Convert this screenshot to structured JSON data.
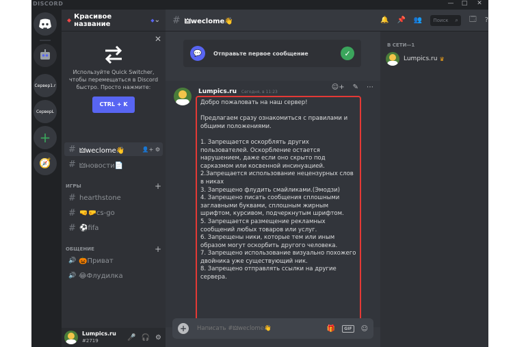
{
  "titlebar": {
    "brand": "DISCORD",
    "min": "—",
    "max": "□",
    "close": "✕"
  },
  "guilds": [
    {
      "name": "home-icon",
      "label": ""
    },
    {
      "name": "bot-server-icon",
      "label": ""
    },
    {
      "name": "server-1",
      "label": "Сервер1.r"
    },
    {
      "name": "server-2",
      "label": "СерверL"
    }
  ],
  "server": {
    "name": "Красивое название",
    "chevron": "⌄"
  },
  "quick_switcher": {
    "text": "Используйте Quick Switcher, чтобы перемещаться в Discord быстро. Просто нажмите:",
    "button": "CTRL + K",
    "close": "✕"
  },
  "channels": [
    {
      "label": "🜲weclome👋",
      "type": "text",
      "active": true
    },
    {
      "label": "🜲новости📄",
      "type": "text",
      "active": false
    }
  ],
  "categories": [
    {
      "label": "ИГРЫ",
      "channels": [
        {
          "label": "hearthstone",
          "type": "text"
        },
        {
          "label": "🤜🤛cs-go",
          "type": "text"
        },
        {
          "label": "⚽fifa",
          "type": "text"
        }
      ]
    },
    {
      "label": "ОБЩЕНИЕ",
      "channels": [
        {
          "label": "🎃Приват",
          "type": "voice"
        },
        {
          "label": "😂Флудилка",
          "type": "voice"
        }
      ]
    }
  ],
  "user": {
    "name": "Lumpics.ru",
    "tag": "#2719"
  },
  "topbar": {
    "channel": "🜲weclome👋",
    "search_placeholder": "Поиск"
  },
  "welcome_card": {
    "text": "Отправьте первое сообщение"
  },
  "message": {
    "author": "Lumpics.ru",
    "time": "Сегодня, в 11:23",
    "text": "Добро пожаловать на наш сервер!\n\nПредлагаем сразу ознакомиться с правилами и общими положениями.\n\n1. Запрещается оскорблять других пользователей. Оскорбление остается нарушением, даже если оно скрыто под сарказмом или косвенной инсинуацией.\n2.Запрещается использование нецензурных слов в никах\n3. Запрещено флудить смайликами.(Эмодзи)\n4. Запрещено писать сообщения сплошными заглавными буквами, сплошным жирным шрифтом, курсивом, подчеркнутым шрифтом.\n5. Запрещается размещение рекламных сообщений любых товаров или услуг.\n6. Запрещены ники, которые тем или иным образом могут оскорбить другого человека.\n7. Запрещено использование визуально похожего двойника уже существующий ник.\n8. Запрещено отправлять ссылки на другие сервера."
  },
  "composer": {
    "placeholder": "Написать #🜲weclome👋"
  },
  "members": {
    "category": "В СЕТИ—1",
    "list": [
      {
        "name": "Lumpics.ru"
      }
    ]
  }
}
